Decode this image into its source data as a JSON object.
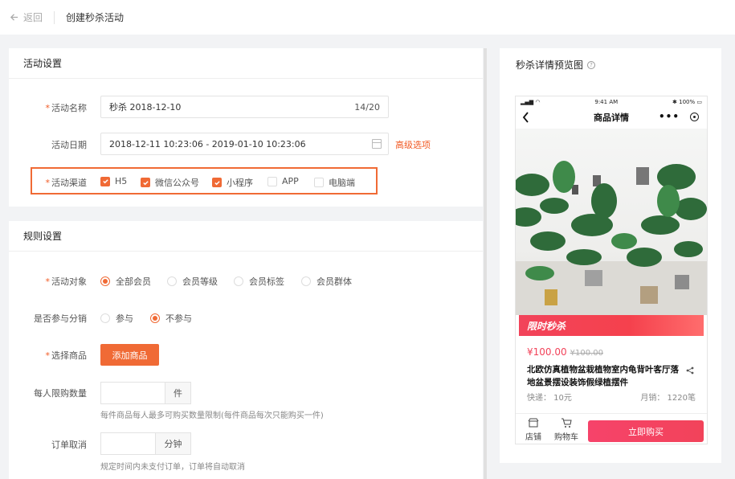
{
  "header": {
    "back_label": "返回",
    "title": "创建秒杀活动"
  },
  "activity_settings": {
    "section_title": "活动设置",
    "name": {
      "label": "活动名称",
      "value": "秒杀  2018-12-10",
      "counter": "14/20"
    },
    "date": {
      "label": "活动日期",
      "value": "2018-12-11 10:23:06 - 2019-01-10 10:23:06",
      "advanced_link": "高级选项"
    },
    "channels": {
      "label": "活动渠道",
      "options": [
        {
          "label": "H5",
          "checked": true
        },
        {
          "label": "微信公众号",
          "checked": true
        },
        {
          "label": "小程序",
          "checked": true
        },
        {
          "label": "APP",
          "checked": false
        },
        {
          "label": "电脑端",
          "checked": false
        }
      ]
    }
  },
  "rule_settings": {
    "section_title": "规则设置",
    "target": {
      "label": "活动对象",
      "options": [
        {
          "label": "全部会员",
          "selected": true
        },
        {
          "label": "会员等级",
          "selected": false
        },
        {
          "label": "会员标签",
          "selected": false
        },
        {
          "label": "会员群体",
          "selected": false
        }
      ]
    },
    "distribution": {
      "label": "是否参与分销",
      "options": [
        {
          "label": "参与",
          "selected": false
        },
        {
          "label": "不参与",
          "selected": true
        }
      ]
    },
    "goods": {
      "label": "选择商品",
      "button": "添加商品"
    },
    "limit": {
      "label": "每人限购数量",
      "value": "",
      "suffix": "件",
      "hint": "每件商品每人最多可购买数量限制(每件商品每次只能购买一件)"
    },
    "cancel": {
      "label": "订单取消",
      "value": "",
      "suffix": "分钟",
      "hint": "规定时间内未支付订单，订单将自动取消"
    }
  },
  "preview": {
    "title": "秒杀详情预览图",
    "help_icon": "?",
    "status_time": "9:41 AM",
    "status_battery": "100%",
    "nav_title": "商品详情",
    "nav_more": "•••",
    "flash_label": "限时秒杀",
    "price": "¥100.00",
    "original_price": "¥100.00",
    "product_title": "北欧仿真植物盆栽植物室内龟背叶客厅落地盆景摆设装饰假绿植摆件",
    "shipping": "快递： 10元",
    "monthly_sales": "月销： 1220笔",
    "store_label": "店铺",
    "cart_label": "购物车",
    "buy_button": "立即购买"
  },
  "colors": {
    "accent": "#f06a35",
    "flash": "#f2435a"
  }
}
